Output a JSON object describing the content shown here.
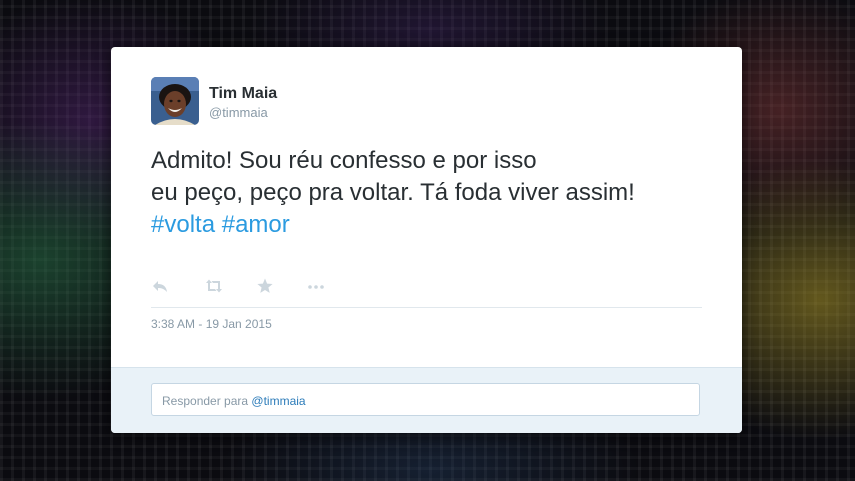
{
  "tweet": {
    "author_name": "Tim Maia",
    "author_handle": "@timmaia",
    "text_line1": "Admito! Sou réu confesso e por isso",
    "text_line2": "eu peço, peço pra voltar. Tá foda viver assim!",
    "hashtag1": "#volta",
    "hashtag2": "#amor",
    "timestamp": "3:38 AM - 19 Jan 2015"
  },
  "actions": [
    {
      "icon": "reply-icon"
    },
    {
      "icon": "retweet-icon"
    },
    {
      "icon": "favorite-star-icon"
    },
    {
      "icon": "more-options-icon"
    }
  ],
  "reply": {
    "prefix": "Responder para",
    "mention": "@timmaia"
  },
  "colors": {
    "hashtag": "#2b9be0",
    "mention": "#2b7bb9",
    "text": "#292f33",
    "muted": "#8899a6",
    "reply_bar": "#e9f2f8"
  }
}
